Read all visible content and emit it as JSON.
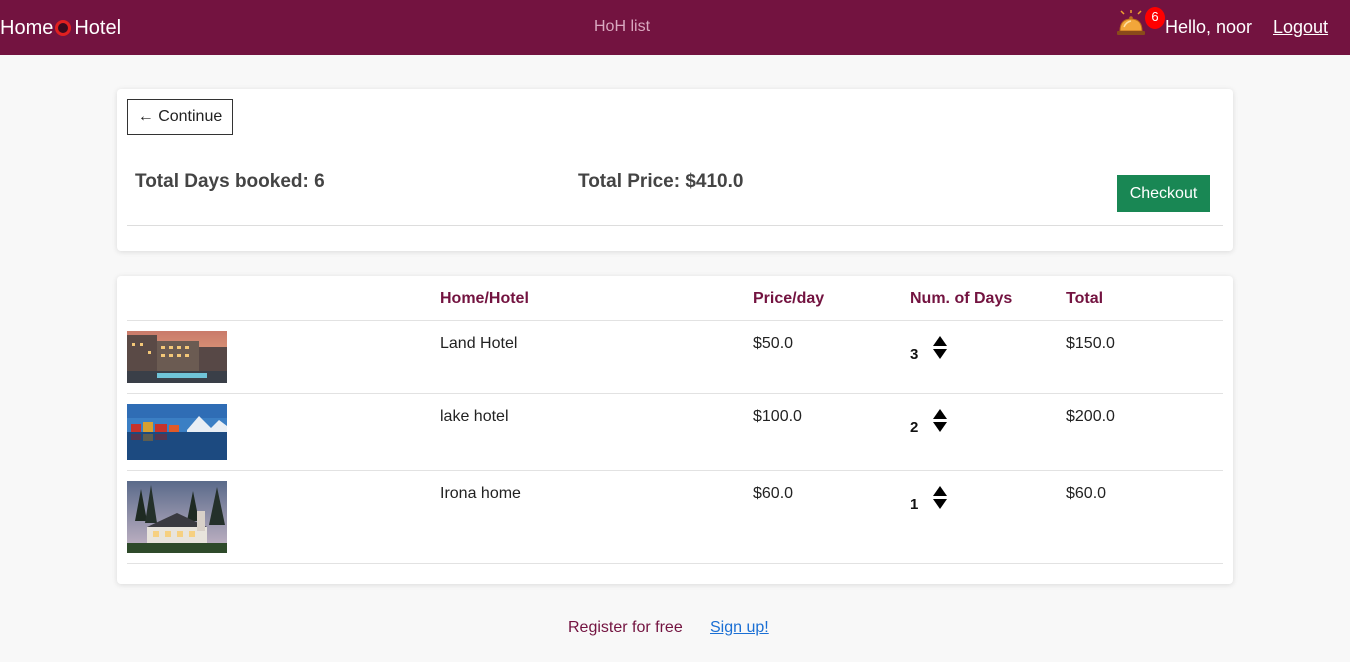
{
  "navbar": {
    "brand_left": "Home",
    "brand_right": "Hotel",
    "center_link": "HoH list",
    "notification_count": "6",
    "greeting": "Hello, noor",
    "logout_label": "Logout",
    "bg_color": "#731340"
  },
  "summary": {
    "continue_label": "← Continue",
    "total_days": "Total Days booked: 6",
    "total_price": "Total Price: $410.0",
    "checkout_label": "Checkout"
  },
  "table": {
    "headers": [
      "",
      "Home/Hotel",
      "Price/day",
      "Num. of Days",
      "Total"
    ],
    "rows": [
      {
        "name": "Land Hotel",
        "price": "$50.0",
        "days": "3",
        "total": "$150.0"
      },
      {
        "name": "lake hotel",
        "price": "$100.0",
        "days": "2",
        "total": "$200.0"
      },
      {
        "name": "Irona home",
        "price": "$60.0",
        "days": "1",
        "total": "$60.0"
      }
    ]
  },
  "footer": {
    "text": "Register for free",
    "link": "Sign up!"
  }
}
